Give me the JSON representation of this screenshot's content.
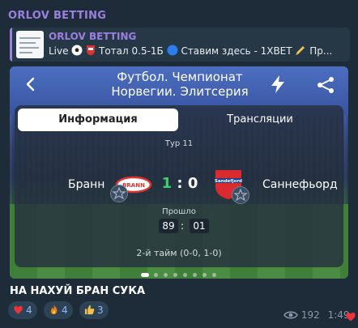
{
  "channel": {
    "name": "ORLOV BETTING"
  },
  "reply": {
    "title": "ORLOV BETTING",
    "text_live": "Live",
    "text_total": "Тотал 0.5-1Б",
    "text_bet": "Ставим здесь - 1XBET",
    "text_tail": "Пр..."
  },
  "card": {
    "title_line1": "Футбол. Чемпионат",
    "title_line2": "Норвегии. Элитсерия",
    "tabs": {
      "info": "Информация",
      "streams": "Трансляции"
    },
    "round": "Тур 11",
    "home_team": "Бранн",
    "away_team": "Саннефьорд",
    "home_logo_text": "BRANN",
    "away_logo_text": "Sandefjord",
    "score_home": "1",
    "score_sep": ":",
    "score_away": "0",
    "passed_label": "Прошло",
    "timer_min": "89",
    "timer_sep": ":",
    "timer_sec": "01",
    "half_info": "2-й тайм (0-0, 1-0)"
  },
  "message": {
    "text": "НА НАХУЙ БРАН СУКА"
  },
  "reactions": [
    {
      "emoji": "❤️",
      "count": "4",
      "icon": "heart-icon"
    },
    {
      "emoji": "🔥",
      "count": "4",
      "icon": "fire-icon"
    },
    {
      "emoji": "👍",
      "count": "3",
      "icon": "thumbs-up-icon"
    }
  ],
  "meta": {
    "views": "192",
    "time": "1:49"
  },
  "colors": {
    "accent": "#9b7fe0",
    "score_home": "#3dd16a",
    "background": "#1e2c3a"
  }
}
